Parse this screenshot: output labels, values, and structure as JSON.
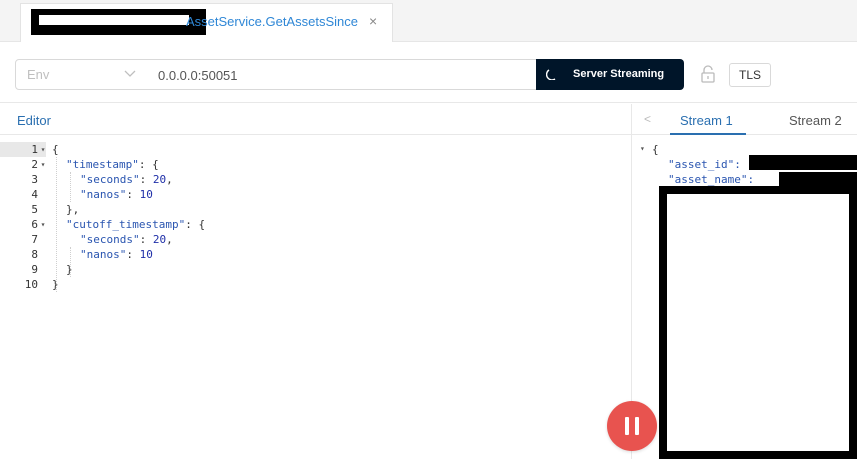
{
  "tab": {
    "title": "AssetService.GetAssetsSince",
    "close_glyph": "×"
  },
  "toolbar": {
    "env_placeholder": "Env",
    "address_value": "0.0.0.0:50051",
    "stream_button_label": "Server Streaming",
    "tls_label": "TLS"
  },
  "editor": {
    "title": "Editor",
    "lines": [
      {
        "no": "1",
        "fold": "▾",
        "text": "{"
      },
      {
        "no": "2",
        "fold": "▾",
        "key": "\"timestamp\"",
        "rest": ": {"
      },
      {
        "no": "3",
        "fold": "",
        "key": "\"seconds\"",
        "sep": ": ",
        "num": "20",
        "tail": ","
      },
      {
        "no": "4",
        "fold": "",
        "key": "\"nanos\"",
        "sep": ": ",
        "num": "10",
        "tail": ""
      },
      {
        "no": "5",
        "fold": "",
        "text": "},"
      },
      {
        "no": "6",
        "fold": "▾",
        "key": "\"cutoff_timestamp\"",
        "rest": ": {"
      },
      {
        "no": "7",
        "fold": "",
        "key": "\"seconds\"",
        "sep": ": ",
        "num": "20",
        "tail": ","
      },
      {
        "no": "8",
        "fold": "",
        "key": "\"nanos\"",
        "sep": ": ",
        "num": "10",
        "tail": ""
      },
      {
        "no": "9",
        "fold": "",
        "text": "}"
      },
      {
        "no": "10",
        "fold": "",
        "text": "}"
      }
    ]
  },
  "stream": {
    "prev_glyph": "<",
    "tab1": "Stream 1",
    "tab2": "Stream 2",
    "brace": "{",
    "key_asset_id": "\"asset_id\": ",
    "key_asset_name": "\"asset_name\": "
  },
  "colors": {
    "accent": "#2a6fb0",
    "stream_button": "#001529",
    "pause_button": "#e8534f"
  },
  "icons": {
    "env_chevron": "chevron-down-icon",
    "stream_spinner": "spinner-icon",
    "lock": "unlock-icon",
    "pause": "pause-icon"
  }
}
